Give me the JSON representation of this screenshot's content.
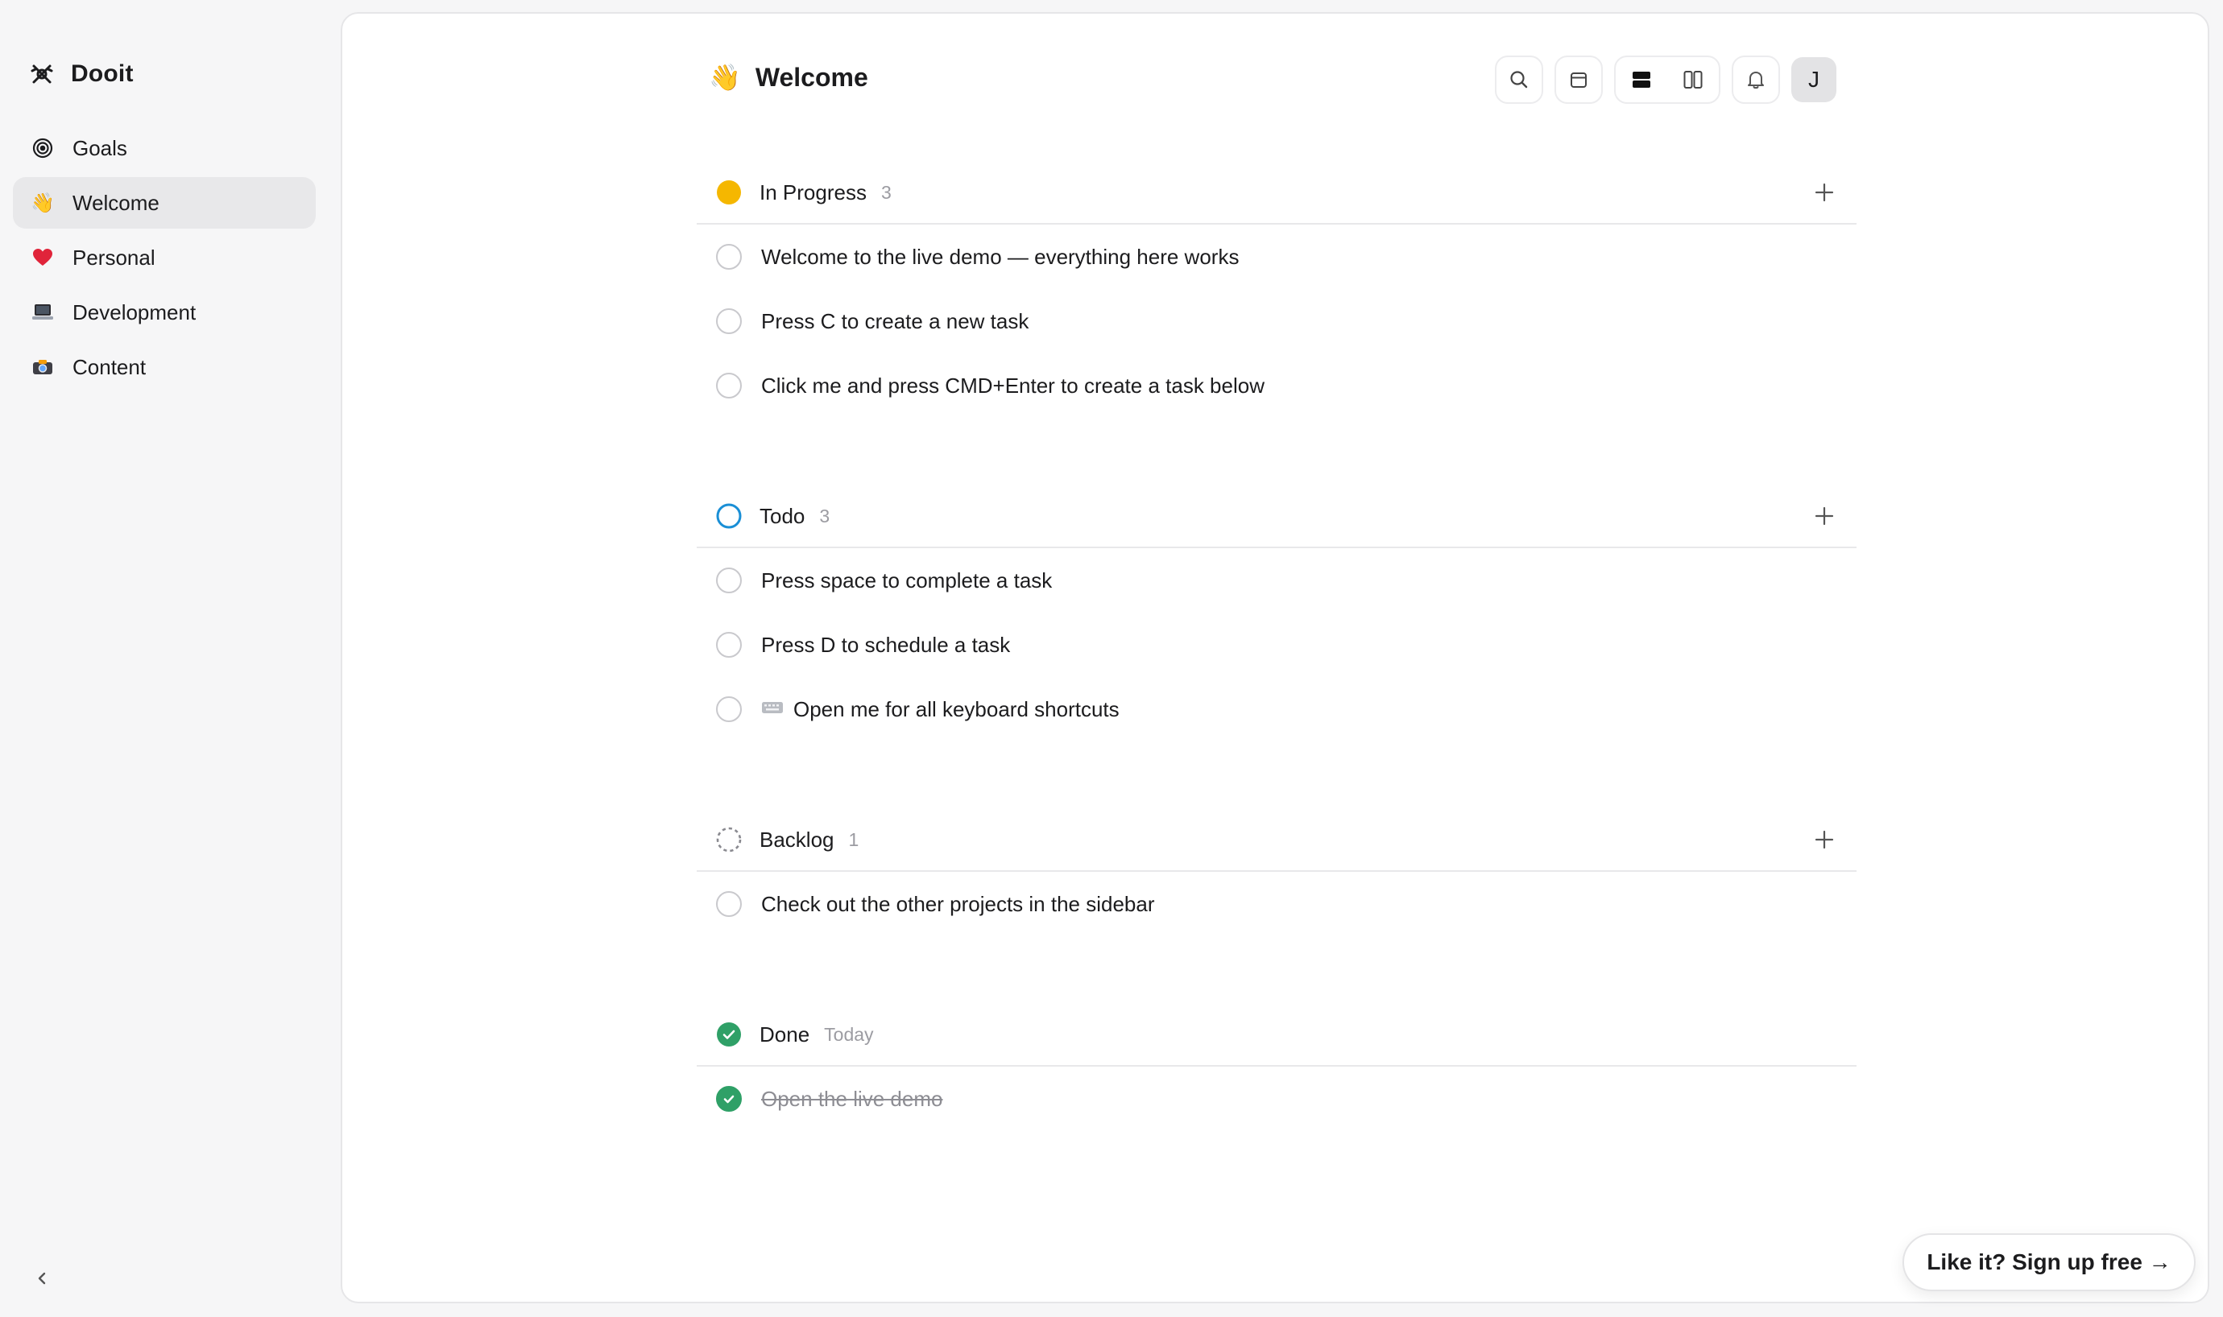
{
  "sidebar": {
    "brand": "Dooit",
    "items": [
      {
        "label": "Goals",
        "icon": "target-icon",
        "active": false
      },
      {
        "label": "Welcome",
        "icon": "waving-hand-icon",
        "emoji": "👋",
        "active": true
      },
      {
        "label": "Personal",
        "icon": "heart-icon",
        "emoji": "❤️",
        "active": false
      },
      {
        "label": "Development",
        "icon": "laptop-icon",
        "emoji": "💻",
        "active": false
      },
      {
        "label": "Content",
        "icon": "camera-icon",
        "emoji": "📸",
        "active": false
      }
    ]
  },
  "header": {
    "title_emoji": "👋",
    "title": "Welcome",
    "avatar_initial": "J"
  },
  "sections": {
    "in_progress": {
      "title": "In Progress",
      "count": "3",
      "tasks": [
        "Welcome to the live demo — everything here works",
        "Press C to create a new task",
        "Click me and press CMD+Enter to create a task below"
      ]
    },
    "todo": {
      "title": "Todo",
      "count": "3",
      "tasks": [
        "Press space to complete a task",
        "Press D to schedule a task",
        "Open me for all keyboard shortcuts"
      ]
    },
    "backlog": {
      "title": "Backlog",
      "count": "1",
      "tasks": [
        "Check out the other projects in the sidebar"
      ]
    },
    "done": {
      "title": "Done",
      "subtitle": "Today",
      "tasks": [
        "Open the live demo"
      ]
    }
  },
  "colors": {
    "in_progress": "#f5b700",
    "todo": "#1a8fd6",
    "done": "#2fa067"
  },
  "cta": {
    "label": "Like it? Sign up free →"
  }
}
